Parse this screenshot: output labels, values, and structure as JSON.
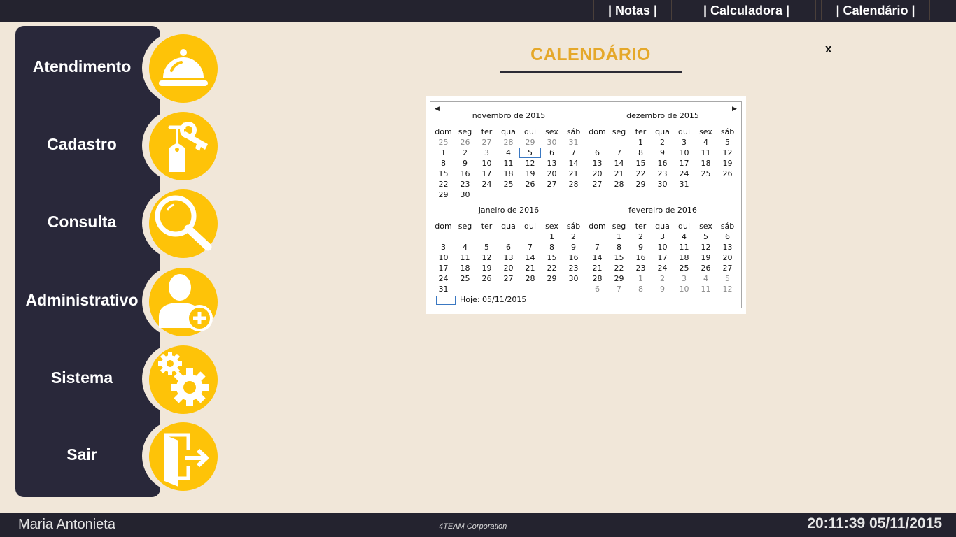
{
  "topbar": {
    "tabs": [
      {
        "label": "| Notas |"
      },
      {
        "label": "| Calculadora |"
      },
      {
        "label": "| Calendário |"
      }
    ]
  },
  "sidebar": {
    "items": [
      {
        "label": "Atendimento",
        "icon": "service-bell-icon"
      },
      {
        "label": "Cadastro",
        "icon": "key-tag-icon"
      },
      {
        "label": "Consulta",
        "icon": "magnifier-icon"
      },
      {
        "label": "Administrativo",
        "icon": "add-user-icon"
      },
      {
        "label": "Sistema",
        "icon": "gears-icon"
      },
      {
        "label": "Sair",
        "icon": "exit-door-icon"
      }
    ]
  },
  "main": {
    "title": "CALENDÁRIO",
    "close_label": "x"
  },
  "calendar": {
    "weekdays": [
      "dom",
      "seg",
      "ter",
      "qua",
      "qui",
      "sex",
      "sáb"
    ],
    "months": [
      {
        "title": "novembro de 2015",
        "weeks": [
          [
            [
              "25",
              1
            ],
            [
              "26",
              1
            ],
            [
              "27",
              1
            ],
            [
              "28",
              1
            ],
            [
              "29",
              1
            ],
            [
              "30",
              1
            ],
            [
              "31",
              1
            ]
          ],
          [
            [
              "1",
              0
            ],
            [
              "2",
              0
            ],
            [
              "3",
              0
            ],
            [
              "4",
              0
            ],
            [
              "5",
              2
            ],
            [
              "6",
              0
            ],
            [
              "7",
              0
            ]
          ],
          [
            [
              "8",
              0
            ],
            [
              "9",
              0
            ],
            [
              "10",
              0
            ],
            [
              "11",
              0
            ],
            [
              "12",
              0
            ],
            [
              "13",
              0
            ],
            [
              "14",
              0
            ]
          ],
          [
            [
              "15",
              0
            ],
            [
              "16",
              0
            ],
            [
              "17",
              0
            ],
            [
              "18",
              0
            ],
            [
              "19",
              0
            ],
            [
              "20",
              0
            ],
            [
              "21",
              0
            ]
          ],
          [
            [
              "22",
              0
            ],
            [
              "23",
              0
            ],
            [
              "24",
              0
            ],
            [
              "25",
              0
            ],
            [
              "26",
              0
            ],
            [
              "27",
              0
            ],
            [
              "28",
              0
            ]
          ],
          [
            [
              "29",
              0
            ],
            [
              "30",
              0
            ],
            [
              "",
              0
            ],
            [
              "",
              0
            ],
            [
              "",
              0
            ],
            [
              "",
              0
            ],
            [
              "",
              0
            ]
          ]
        ]
      },
      {
        "title": "dezembro de 2015",
        "weeks": [
          [
            [
              "",
              0
            ],
            [
              "",
              0
            ],
            [
              "1",
              0
            ],
            [
              "2",
              0
            ],
            [
              "3",
              0
            ],
            [
              "4",
              0
            ],
            [
              "5",
              0
            ]
          ],
          [
            [
              "6",
              0
            ],
            [
              "7",
              0
            ],
            [
              "8",
              0
            ],
            [
              "9",
              0
            ],
            [
              "10",
              0
            ],
            [
              "11",
              0
            ],
            [
              "12",
              0
            ]
          ],
          [
            [
              "13",
              0
            ],
            [
              "14",
              0
            ],
            [
              "15",
              0
            ],
            [
              "16",
              0
            ],
            [
              "17",
              0
            ],
            [
              "18",
              0
            ],
            [
              "19",
              0
            ]
          ],
          [
            [
              "20",
              0
            ],
            [
              "21",
              0
            ],
            [
              "22",
              0
            ],
            [
              "23",
              0
            ],
            [
              "24",
              0
            ],
            [
              "25",
              0
            ],
            [
              "26",
              0
            ]
          ],
          [
            [
              "27",
              0
            ],
            [
              "28",
              0
            ],
            [
              "29",
              0
            ],
            [
              "30",
              0
            ],
            [
              "31",
              0
            ],
            [
              "",
              0
            ],
            [
              "",
              0
            ]
          ],
          [
            [
              "",
              0
            ],
            [
              "",
              0
            ],
            [
              "",
              0
            ],
            [
              "",
              0
            ],
            [
              "",
              0
            ],
            [
              "",
              0
            ],
            [
              "",
              0
            ]
          ]
        ]
      },
      {
        "title": "janeiro de 2016",
        "weeks": [
          [
            [
              "",
              0
            ],
            [
              "",
              0
            ],
            [
              "",
              0
            ],
            [
              "",
              0
            ],
            [
              "",
              0
            ],
            [
              "1",
              0
            ],
            [
              "2",
              0
            ]
          ],
          [
            [
              "3",
              0
            ],
            [
              "4",
              0
            ],
            [
              "5",
              0
            ],
            [
              "6",
              0
            ],
            [
              "7",
              0
            ],
            [
              "8",
              0
            ],
            [
              "9",
              0
            ]
          ],
          [
            [
              "10",
              0
            ],
            [
              "11",
              0
            ],
            [
              "12",
              0
            ],
            [
              "13",
              0
            ],
            [
              "14",
              0
            ],
            [
              "15",
              0
            ],
            [
              "16",
              0
            ]
          ],
          [
            [
              "17",
              0
            ],
            [
              "18",
              0
            ],
            [
              "19",
              0
            ],
            [
              "20",
              0
            ],
            [
              "21",
              0
            ],
            [
              "22",
              0
            ],
            [
              "23",
              0
            ]
          ],
          [
            [
              "24",
              0
            ],
            [
              "25",
              0
            ],
            [
              "26",
              0
            ],
            [
              "27",
              0
            ],
            [
              "28",
              0
            ],
            [
              "29",
              0
            ],
            [
              "30",
              0
            ]
          ],
          [
            [
              "31",
              0
            ],
            [
              "",
              0
            ],
            [
              "",
              0
            ],
            [
              "",
              0
            ],
            [
              "",
              0
            ],
            [
              "",
              0
            ],
            [
              "",
              0
            ]
          ]
        ]
      },
      {
        "title": "fevereiro de 2016",
        "weeks": [
          [
            [
              "",
              0
            ],
            [
              "1",
              0
            ],
            [
              "2",
              0
            ],
            [
              "3",
              0
            ],
            [
              "4",
              0
            ],
            [
              "5",
              0
            ],
            [
              "6",
              0
            ]
          ],
          [
            [
              "7",
              0
            ],
            [
              "8",
              0
            ],
            [
              "9",
              0
            ],
            [
              "10",
              0
            ],
            [
              "11",
              0
            ],
            [
              "12",
              0
            ],
            [
              "13",
              0
            ]
          ],
          [
            [
              "14",
              0
            ],
            [
              "15",
              0
            ],
            [
              "16",
              0
            ],
            [
              "17",
              0
            ],
            [
              "18",
              0
            ],
            [
              "19",
              0
            ],
            [
              "20",
              0
            ]
          ],
          [
            [
              "21",
              0
            ],
            [
              "22",
              0
            ],
            [
              "23",
              0
            ],
            [
              "24",
              0
            ],
            [
              "25",
              0
            ],
            [
              "26",
              0
            ],
            [
              "27",
              0
            ]
          ],
          [
            [
              "28",
              0
            ],
            [
              "29",
              0
            ],
            [
              "1",
              1
            ],
            [
              "2",
              1
            ],
            [
              "3",
              1
            ],
            [
              "4",
              1
            ],
            [
              "5",
              1
            ]
          ],
          [
            [
              "6",
              1
            ],
            [
              "7",
              1
            ],
            [
              "8",
              1
            ],
            [
              "9",
              1
            ],
            [
              "10",
              1
            ],
            [
              "11",
              1
            ],
            [
              "12",
              1
            ]
          ]
        ]
      }
    ],
    "today_label": "Hoje: 05/11/2015"
  },
  "footer": {
    "user": "Maria Antonieta",
    "company": "4TEAM Corporation",
    "datetime": "20:11:39 05/11/2015"
  },
  "colors": {
    "bar": "#24232f",
    "sidebar": "#29283a",
    "accent": "#fec308",
    "title": "#e5a82a",
    "background": "#f1e7d9"
  }
}
